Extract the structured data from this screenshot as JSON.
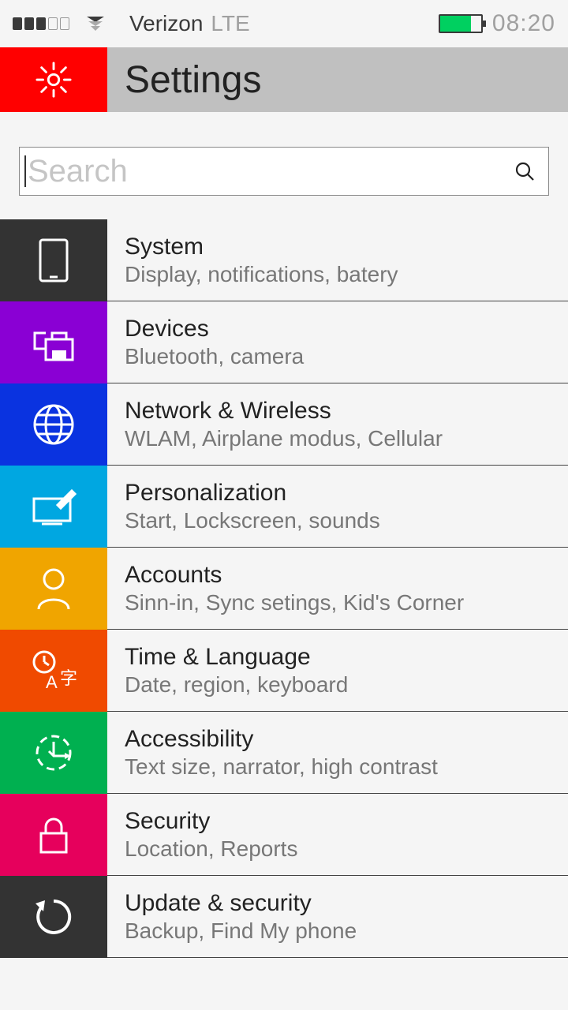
{
  "status": {
    "carrier": "Verizon",
    "network": "LTE",
    "time": "08:20"
  },
  "header": {
    "title": "Settings"
  },
  "search": {
    "placeholder": "Search"
  },
  "items": [
    {
      "title": "System",
      "subtitle": "Display, notifications, batery",
      "color": "#333333"
    },
    {
      "title": "Devices",
      "subtitle": "Bluetooth, camera",
      "color": "#8a00d4"
    },
    {
      "title": "Network & Wireless",
      "subtitle": "WLAM, Airplane modus, Cellular",
      "color": "#0a33e0"
    },
    {
      "title": "Personalization",
      "subtitle": "Start, Lockscreen, sounds",
      "color": "#00a7e1"
    },
    {
      "title": "Accounts",
      "subtitle": "Sinn-in, Sync setings, Kid's Corner",
      "color": "#f0a500"
    },
    {
      "title": "Time & Language",
      "subtitle": "Date, region, keyboard",
      "color": "#f04a00"
    },
    {
      "title": "Accessibility",
      "subtitle": "Text size, narrator, high contrast",
      "color": "#00b050"
    },
    {
      "title": "Security",
      "subtitle": "Location, Reports",
      "color": "#e6005c"
    },
    {
      "title": "Update & security",
      "subtitle": "Backup, Find My phone",
      "color": "#333333"
    }
  ]
}
